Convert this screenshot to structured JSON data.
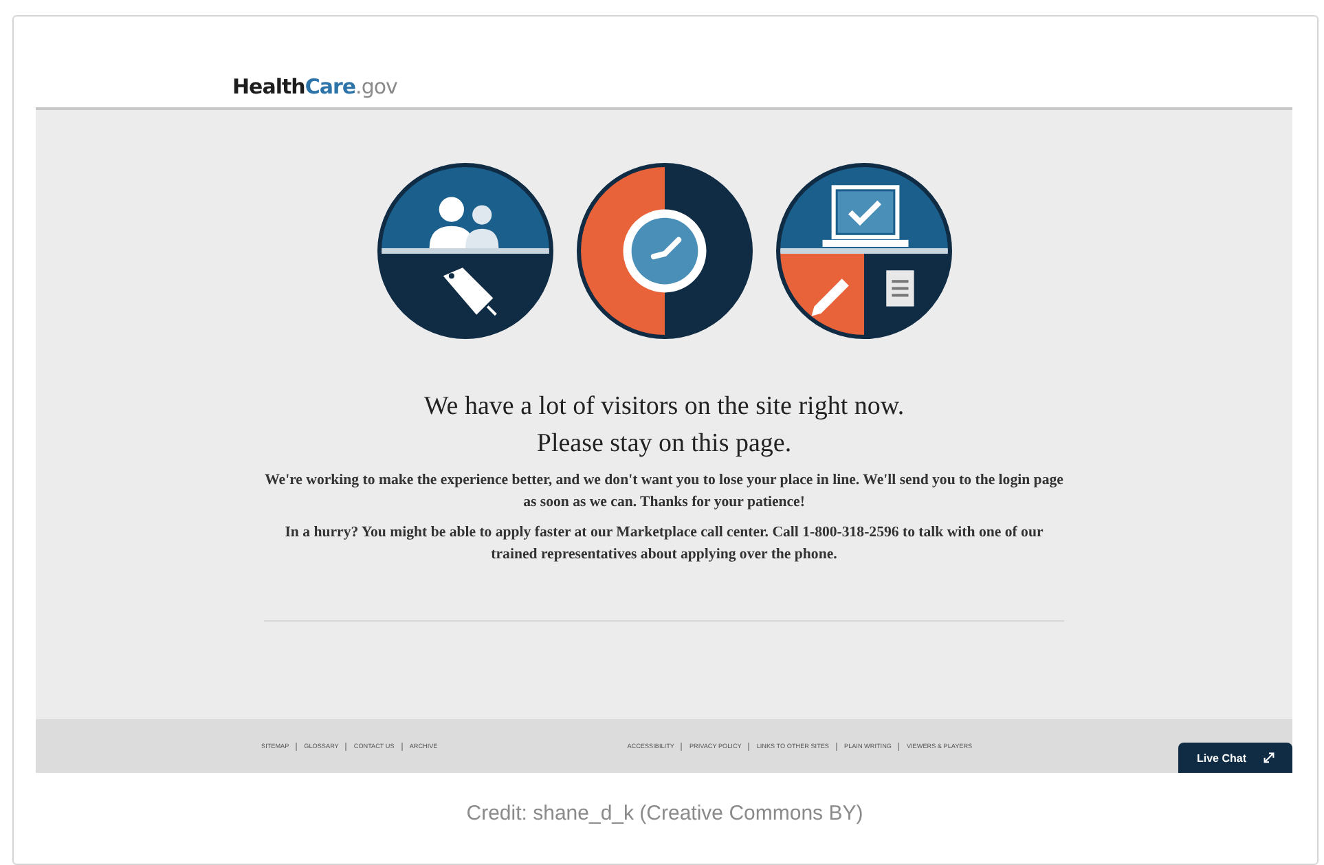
{
  "header": {
    "logo": [
      "Health",
      "Care",
      ".gov"
    ]
  },
  "message": {
    "heading_lines": [
      "We have a lot of visitors on the site right now.",
      "Please stay on this page."
    ],
    "paragraphs": [
      "We're working to make the experience better, and we don't want you to lose your place in line. We'll send you to the login page as soon as we can. Thanks for your patience!",
      "In a hurry? You might be able to apply faster at our Marketplace call center. Call 1-800-318-2596 to talk with one of our trained representatives about applying over the phone."
    ]
  },
  "footer": {
    "left_links": [
      "SITEMAP",
      "GLOSSARY",
      "CONTACT US",
      "ARCHIVE"
    ],
    "right_links": [
      "ACCESSIBILITY",
      "PRIVACY POLICY",
      "LINKS TO OTHER SITES",
      "PLAIN WRITING",
      "VIEWERS & PLAYERS"
    ],
    "chat_button": "Live Chat"
  },
  "caption": "Credit: shane_d_k (Creative Commons BY)"
}
